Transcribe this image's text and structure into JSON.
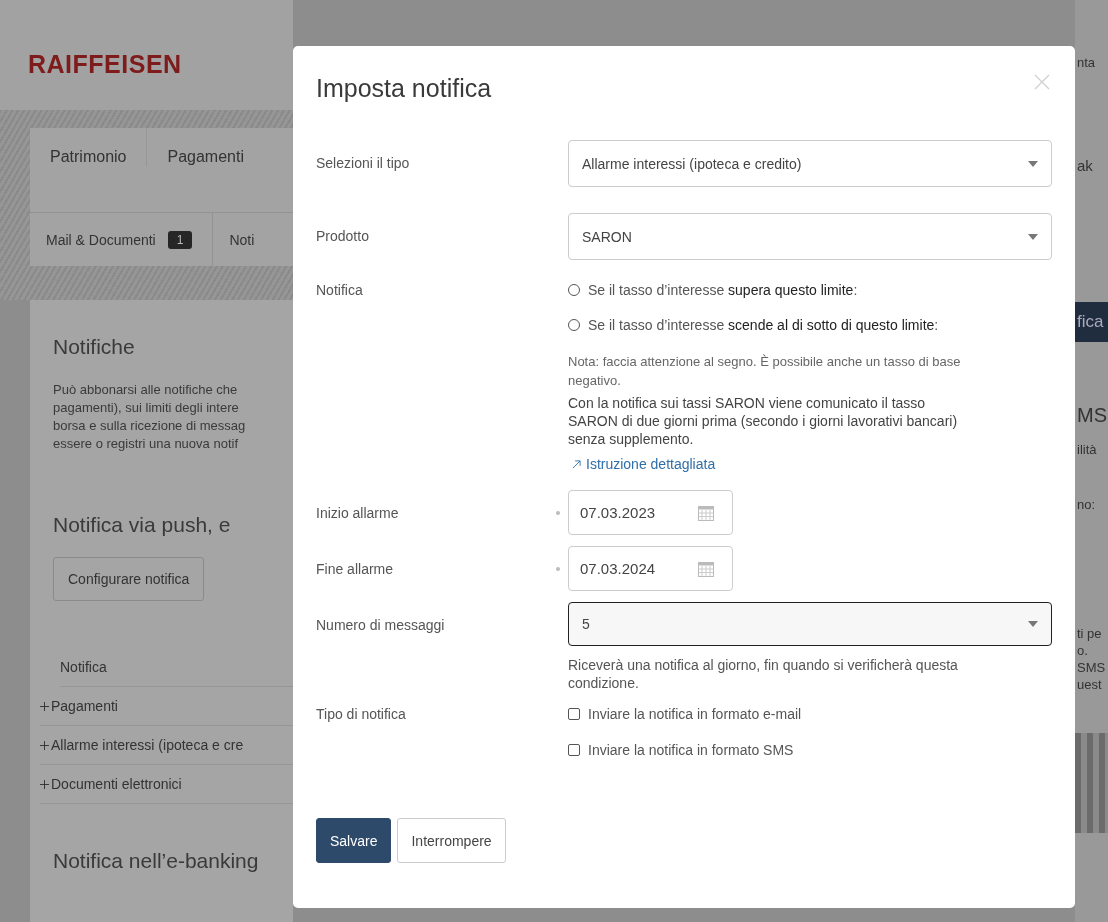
{
  "page": {
    "logo": "RAIFFEISEN",
    "header_right": "nta",
    "nav": [
      {
        "label": "Patrimonio"
      },
      {
        "label": "Pagamenti"
      }
    ],
    "nav_right": "ak",
    "subnav": [
      {
        "label": "Mail & Documenti",
        "badge": "1"
      },
      {
        "label": "Noti"
      }
    ],
    "heading": "Notifiche",
    "intro_lines": [
      "Può abbonarsi alle notifiche che",
      "pagamenti), sui limiti degli intere",
      "borsa e sulla ricezione di messag",
      "essere o registri una nuova notif"
    ],
    "push_heading": "Notifica via push, e",
    "configure_button": "Configurare notifica",
    "table_header": "Notifica",
    "rows": [
      {
        "label": "Pagamenti"
      },
      {
        "label": "Allarme interessi (ipoteca e cre"
      },
      {
        "label": "Documenti elettronici"
      }
    ],
    "ebanking_heading": "Notifica nell’e-banking",
    "right_button": "fica",
    "right_heading": "MS",
    "right_blocks": [
      [
        "ilità"
      ],
      [
        "no:"
      ],
      [
        "ti pe",
        "o.",
        "SMS",
        "uest"
      ]
    ]
  },
  "dialog": {
    "title": "Imposta notifica",
    "type": {
      "label": "Selezioni il tipo",
      "value": "Allarme interessi (ipoteca e credito)"
    },
    "product": {
      "label": "Prodotto",
      "value": "SARON"
    },
    "notification": {
      "label": "Notifica",
      "options": [
        {
          "label": "Se il tasso d’interesse **supera questo limite**:",
          "selected": false
        },
        {
          "label": "Se il tasso d’interesse **scende al di sotto di questo limite**:",
          "selected": false
        }
      ],
      "note": "Nota: faccia attenzione al segno. È possibile anche un tasso di base negativo.",
      "saron_info": "Con la notifica sui tassi SARON viene comunicato il tasso SARON di due giorni prima (secondo i giorni lavorativi bancari) senza supplemento.",
      "link": "Istruzione dettagliata"
    },
    "start": {
      "label": "Inizio allarme",
      "value": "07.03.2023"
    },
    "end": {
      "label": "Fine allarme",
      "value": "07.03.2024"
    },
    "messages": {
      "label": "Numero di messaggi",
      "value": "5",
      "help": "Riceverà una notifica al giorno, fin quando si verificherà questa condizione."
    },
    "delivery": {
      "label": "Tipo di notifica",
      "options": [
        {
          "label": "Inviare la notifica in formato e-mail",
          "checked": false
        },
        {
          "label": "Inviare la notifica in formato SMS",
          "checked": false
        }
      ]
    },
    "buttons": [
      {
        "label": "Salvare",
        "kind": "primary"
      },
      {
        "label": "Interrompere",
        "kind": "secondary"
      }
    ]
  }
}
